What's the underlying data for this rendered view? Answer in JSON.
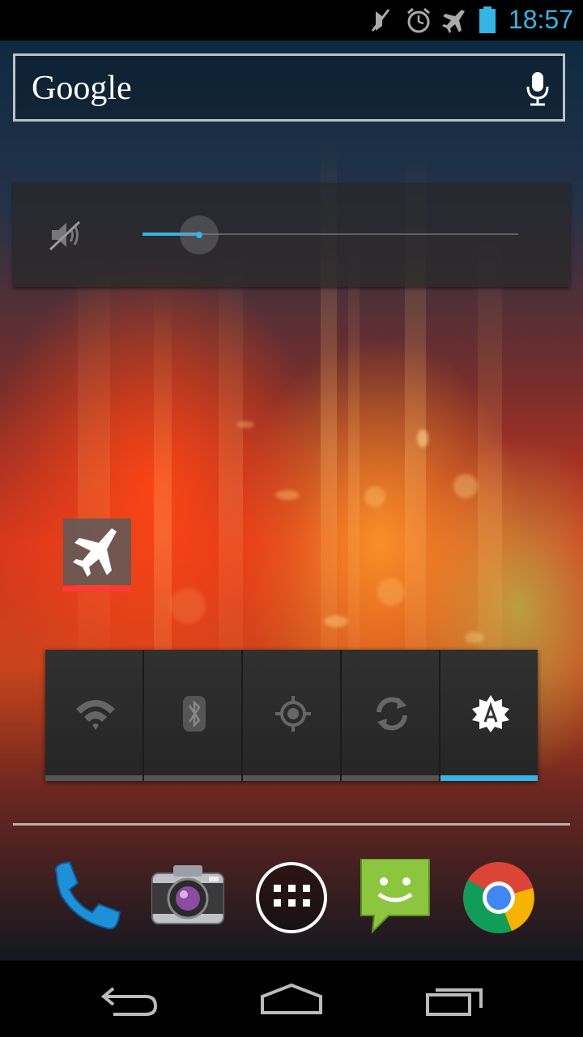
{
  "status_bar": {
    "time": "18:57",
    "icons": [
      "mute-icon",
      "alarm-icon",
      "airplane-mode-icon",
      "battery-icon"
    ],
    "accent_color": "#33b5e5"
  },
  "search_widget": {
    "label": "Google",
    "mic_icon": "microphone-icon"
  },
  "volume_widget": {
    "icon": "speaker-muted-icon",
    "level": 0.15
  },
  "airplane_toggle": {
    "icon": "airplane-icon",
    "state": "off",
    "indicator_color": "#ff3838"
  },
  "power_control": {
    "buttons": [
      {
        "name": "wifi",
        "icon": "wifi-icon",
        "on": false
      },
      {
        "name": "bluetooth",
        "icon": "bluetooth-icon",
        "on": false
      },
      {
        "name": "gps",
        "icon": "gps-icon",
        "on": false
      },
      {
        "name": "sync",
        "icon": "sync-icon",
        "on": false
      },
      {
        "name": "auto-brightness",
        "icon": "auto-brightness-icon",
        "on": true
      }
    ],
    "on_color": "#33b5e5"
  },
  "dock": {
    "apps": [
      "phone-icon",
      "camera-icon",
      "app-drawer-icon",
      "messaging-icon",
      "chrome-icon"
    ]
  },
  "nav_bar": {
    "buttons": [
      "back-icon",
      "home-icon",
      "recents-icon"
    ]
  }
}
